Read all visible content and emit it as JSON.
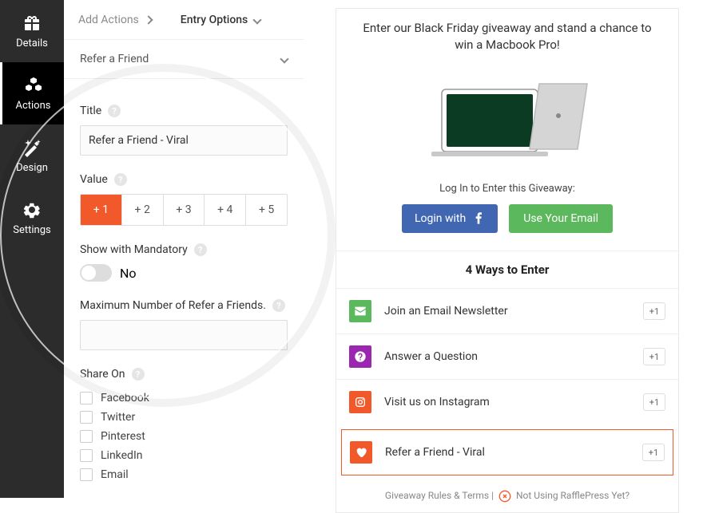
{
  "sidebar": {
    "items": [
      {
        "label": "Details"
      },
      {
        "label": "Actions"
      },
      {
        "label": "Design"
      },
      {
        "label": "Settings"
      }
    ]
  },
  "tabs": {
    "add_actions": "Add Actions",
    "entry_options": "Entry Options"
  },
  "collapse_label": "Refer a Friend",
  "form": {
    "title_label": "Title",
    "title_value": "Refer a Friend - Viral",
    "value_label": "Value",
    "values": [
      "+ 1",
      "+ 2",
      "+ 3",
      "+ 4",
      "+ 5"
    ],
    "show_mandatory_label": "Show with Mandatory",
    "show_mandatory_value": "No",
    "max_label": "Maximum Number of Refer a Friends.",
    "share_on_label": "Share On",
    "share_options": [
      "Facebook",
      "Twitter",
      "Pinterest",
      "LinkedIn",
      "Email"
    ]
  },
  "preview": {
    "headline": "Enter our Black Friday giveaway and stand a chance to win a Macbook Pro!",
    "login_text": "Log In to Enter this Giveaway:",
    "login_with": "Login with",
    "use_email": "Use Your Email",
    "ways_header": "4 Ways to Enter",
    "ways": [
      {
        "label": "Join an Email Newsletter",
        "badge": "+1",
        "color": "#5cb85c"
      },
      {
        "label": "Answer a Question",
        "badge": "+1",
        "color": "#9b27b0"
      },
      {
        "label": "Visit us on Instagram",
        "badge": "+1",
        "color": "#f1592a"
      },
      {
        "label": "Refer a Friend - Viral",
        "badge": "+1",
        "color": "#f1592a"
      }
    ],
    "footer_rules": "Giveaway Rules & Terms",
    "footer_sep": " | ",
    "footer_promo": "Not Using RafflePress Yet?"
  }
}
